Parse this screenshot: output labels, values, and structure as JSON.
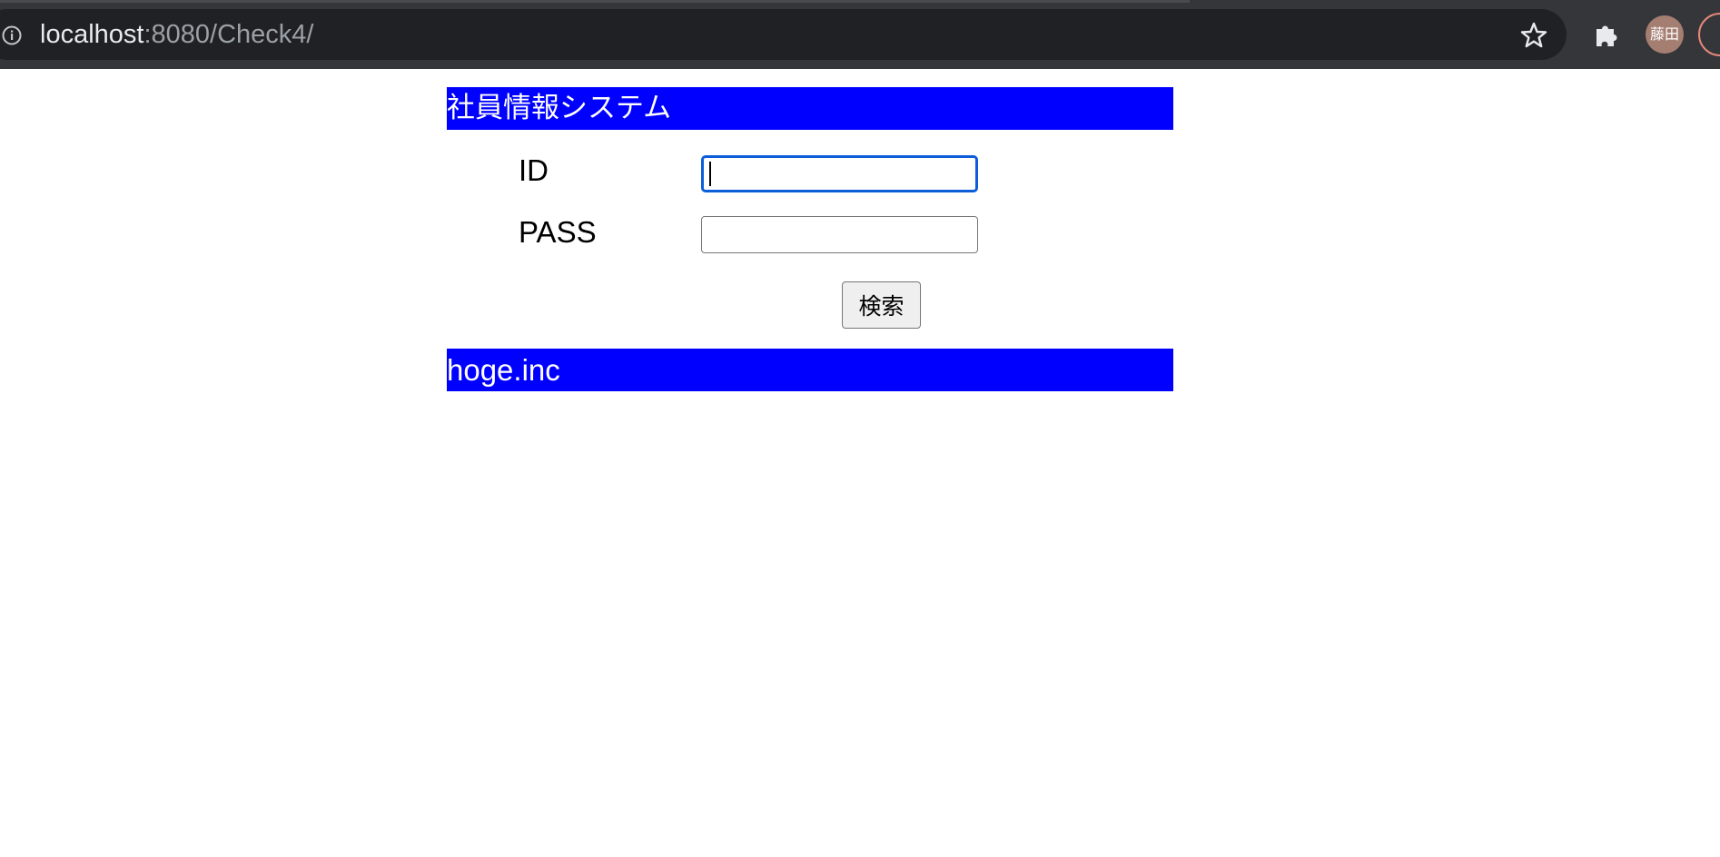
{
  "browser": {
    "url_host": "localhost",
    "url_rest": ":8080/Check4/",
    "profile_label": "藤田",
    "icons": {
      "site_info": "info-icon",
      "bookmark": "star-icon",
      "extensions": "puzzle-icon"
    },
    "colors": {
      "chrome_bg": "#35363a",
      "omnibox_bg": "#202124",
      "avatar_bg": "#a57e72"
    }
  },
  "page": {
    "header_title": "社員情報システム",
    "footer_text": "hoge.inc",
    "bar_color": "#0000ff",
    "form": {
      "id_label": "ID",
      "id_value": "",
      "pass_label": "PASS",
      "pass_value": "",
      "submit_label": "検索"
    }
  }
}
